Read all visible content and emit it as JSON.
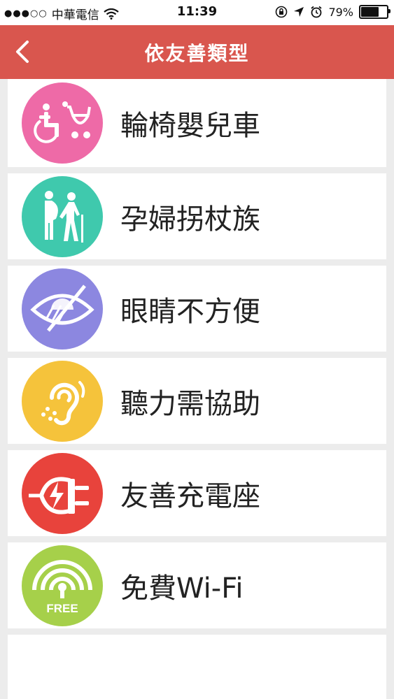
{
  "status_bar": {
    "carrier": "中華電信",
    "time": "11:39",
    "battery": "79%",
    "battery_level": 0.79
  },
  "navbar": {
    "title": "依友善類型",
    "back_icon": "chevron-left-icon"
  },
  "items": [
    {
      "label": "輪椅嬰兒車",
      "icon": "wheelchair-stroller-icon",
      "color": "#ee6aa7"
    },
    {
      "label": "孕婦拐杖族",
      "icon": "pregnant-elderly-icon",
      "color": "#3fc9ad"
    },
    {
      "label": "眼睛不方便",
      "icon": "visually-impaired-icon",
      "color": "#8c87e0"
    },
    {
      "label": "聽力需協助",
      "icon": "hearing-impaired-icon",
      "color": "#f5c33b"
    },
    {
      "label": "友善充電座",
      "icon": "charging-plug-icon",
      "color": "#e8433c"
    },
    {
      "label": "免費Wi-Fi",
      "icon": "free-wifi-icon",
      "color": "#a6d04a",
      "icon_text": "FREE"
    }
  ],
  "colors": {
    "navbar": "#d9564e",
    "background": "#ececec"
  }
}
